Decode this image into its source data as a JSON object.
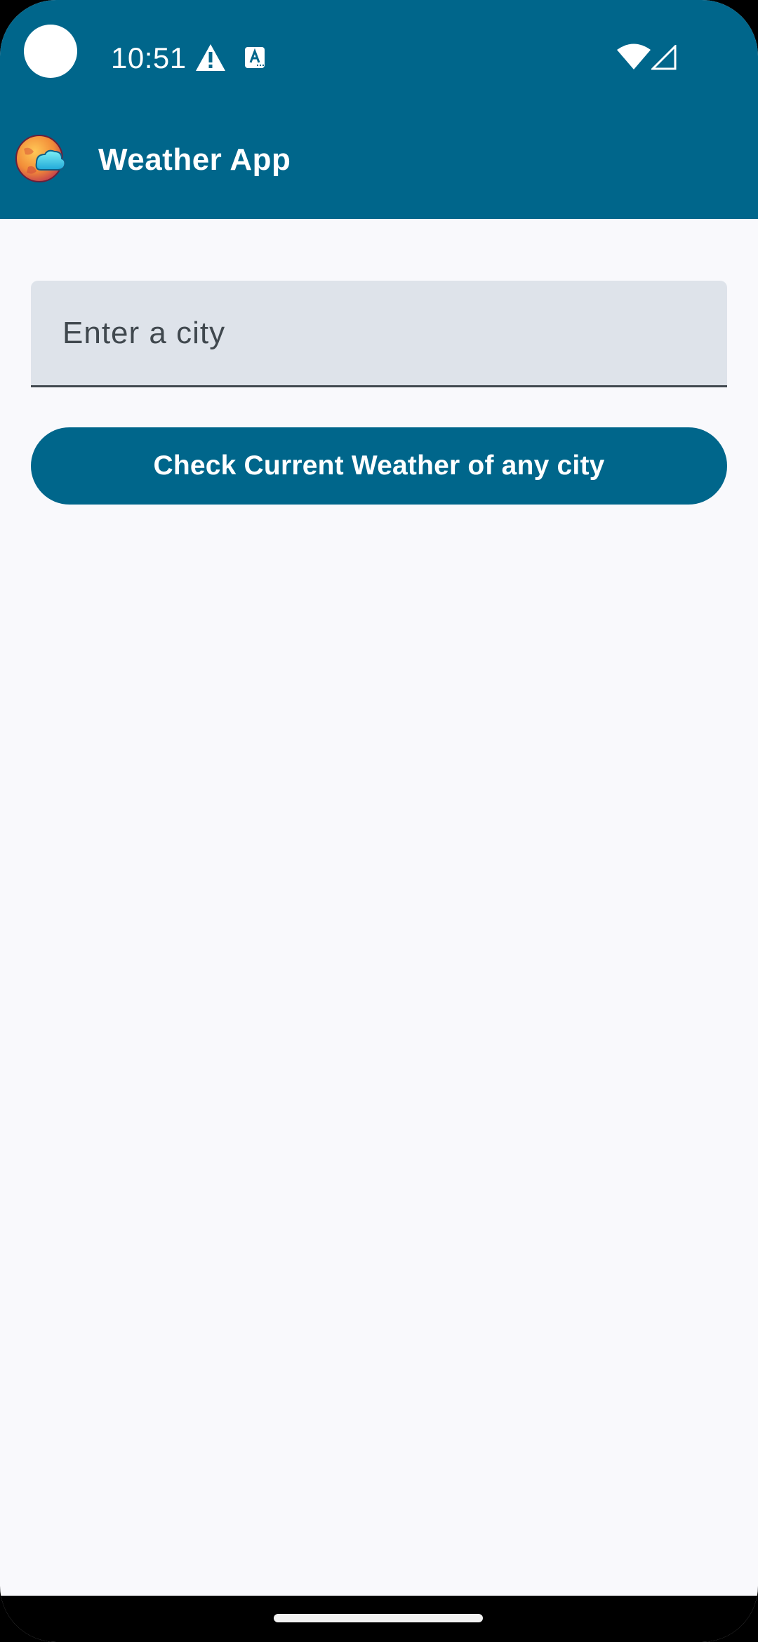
{
  "status_bar": {
    "time": "10:51",
    "icons": [
      "camera-cutout",
      "warning-icon",
      "accessibility-icon",
      "wifi-icon",
      "signal-icon"
    ]
  },
  "app_bar": {
    "title": "Weather App",
    "logo_icon": "weather-globe-cloud-icon"
  },
  "city_field": {
    "value": "",
    "placeholder": "Enter a city"
  },
  "check_button": {
    "label": "Check Current Weather of any city"
  },
  "colors": {
    "primary": "#00668B",
    "background": "#F9F9FC",
    "field_fill": "#DEE3EA",
    "on_primary": "#FFFFFF"
  }
}
